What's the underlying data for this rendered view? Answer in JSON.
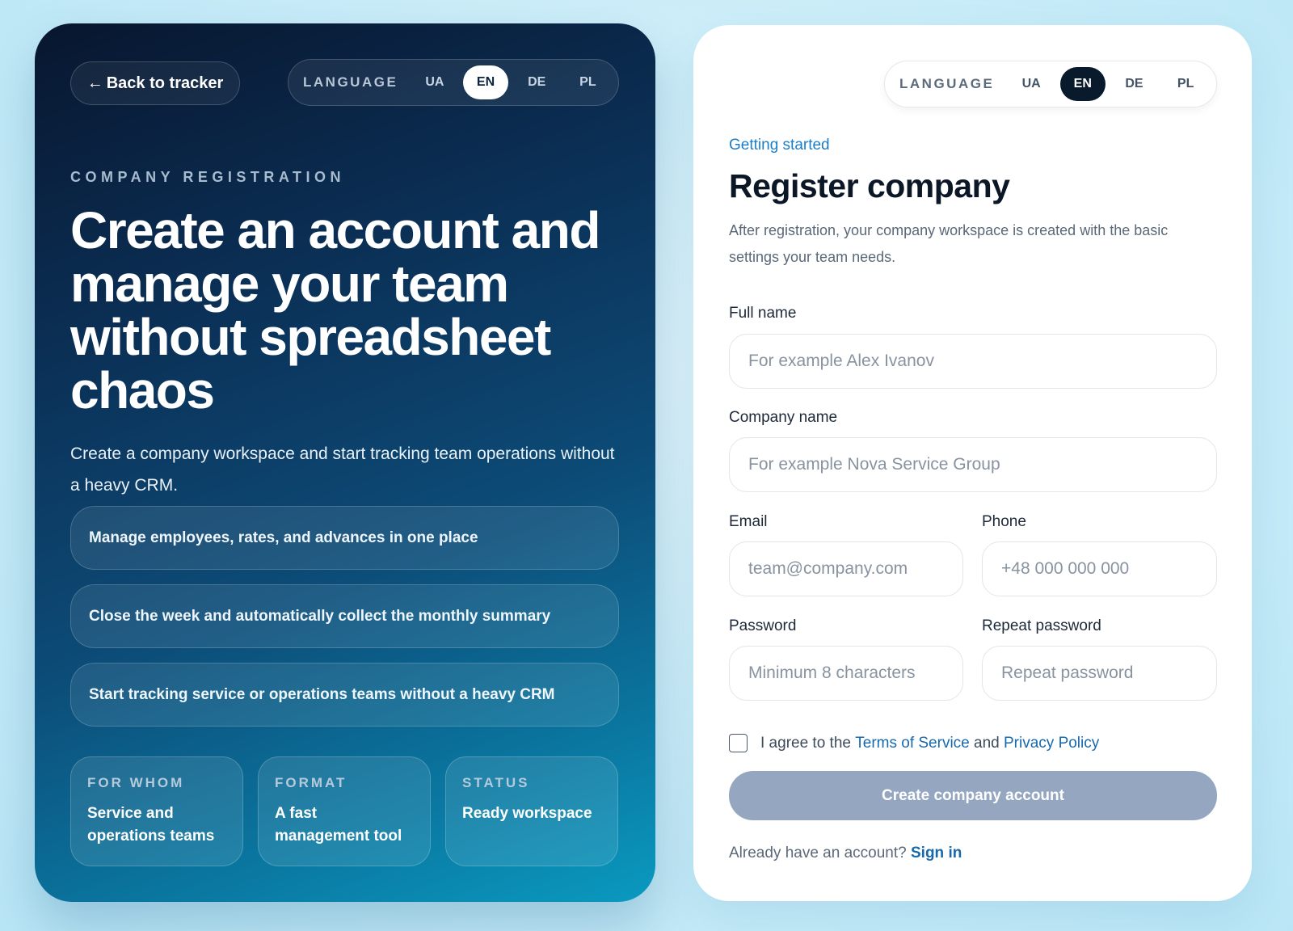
{
  "hero": {
    "back_label": "Back to tracker",
    "language": {
      "label": "LANGUAGE",
      "options": [
        "UA",
        "EN",
        "DE",
        "PL"
      ],
      "selected": "EN"
    },
    "eyebrow": "COMPANY REGISTRATION",
    "headline": "Create an account and manage your team without spreadsheet chaos",
    "lead": "Create a company workspace and start tracking team operations without a heavy CRM.",
    "features": [
      "Manage employees, rates, and advances in one place",
      "Close the week and automatically collect the monthly summary",
      "Start tracking service or operations teams without a heavy CRM"
    ],
    "stats": [
      {
        "label": "FOR WHOM",
        "value": "Service and operations teams"
      },
      {
        "label": "FORMAT",
        "value": "A fast management tool"
      },
      {
        "label": "STATUS",
        "value": "Ready workspace"
      }
    ]
  },
  "form": {
    "language": {
      "label": "LANGUAGE",
      "options": [
        "UA",
        "EN",
        "DE",
        "PL"
      ],
      "selected": "EN"
    },
    "kicker": "Getting started",
    "title": "Register company",
    "description": "After registration, your company workspace is created with the basic settings your team needs.",
    "full_name": {
      "label": "Full name",
      "placeholder": "For example Alex Ivanov"
    },
    "company_name": {
      "label": "Company name",
      "placeholder": "For example Nova Service Group"
    },
    "email": {
      "label": "Email",
      "placeholder": "team@company.com"
    },
    "phone": {
      "label": "Phone",
      "placeholder": "+48 000 000 000"
    },
    "password": {
      "label": "Password",
      "placeholder": "Minimum 8 characters"
    },
    "repeat_password": {
      "label": "Repeat password",
      "placeholder": "Repeat password"
    },
    "agree": {
      "prefix": "I agree to the",
      "terms": "Terms of Service",
      "and": "and",
      "privacy": "Privacy Policy"
    },
    "submit_label": "Create company account",
    "signin_prompt": "Already have an account?",
    "signin_link": "Sign in"
  },
  "colors": {
    "accent_link": "#1769ad",
    "kicker": "#1a7fc8",
    "submit_disabled": "#94a6c0",
    "hero_dark": "#08162e"
  }
}
